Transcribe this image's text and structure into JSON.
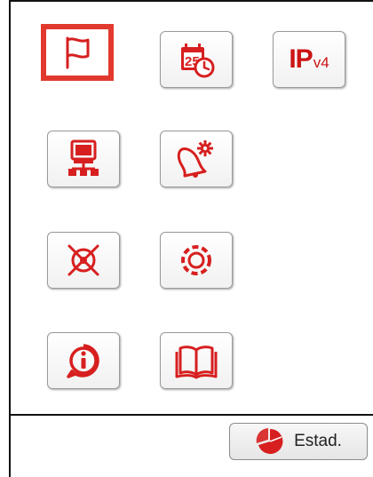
{
  "toolbar": {
    "tiles": [
      {
        "icon": "flag-icon",
        "selected": true
      },
      {
        "icon": "calendar-clock-icon",
        "calendar_day": "25"
      },
      {
        "icon": "ipv4-icon",
        "text_main": "IP",
        "text_sub": "v4"
      },
      {
        "icon": "network-computer-icon"
      },
      {
        "icon": "alarm-bell-settings-icon"
      },
      {
        "icon": "x-circle-icon"
      },
      {
        "icon": "dashed-circle-icon"
      },
      {
        "icon": "info-icon"
      },
      {
        "icon": "book-icon"
      }
    ]
  },
  "footer": {
    "status_button_label": "Estad."
  },
  "colors": {
    "accent": "#d71f1f",
    "selected_border": "#e2392f"
  }
}
